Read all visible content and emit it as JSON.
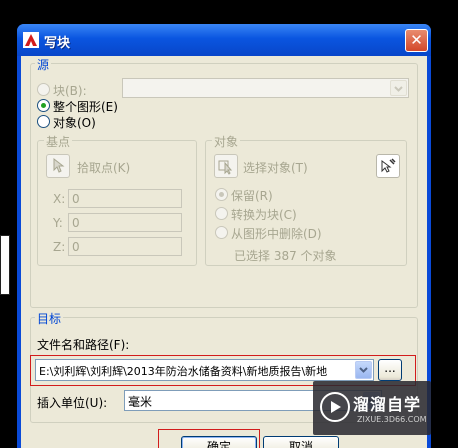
{
  "dialog": {
    "title": "写块",
    "close_label": "✕",
    "source": {
      "legend": "源",
      "block_label": "块(B):",
      "block_value": "",
      "whole_drawing_label": "整个图形(E)",
      "objects_label": "对象(O)",
      "selected": "whole_drawing"
    },
    "base_point": {
      "legend": "基点",
      "pick_point_label": "拾取点(K)",
      "x_label": "X:",
      "y_label": "Y:",
      "z_label": "Z:",
      "x_value": "0",
      "y_value": "0",
      "z_value": "0"
    },
    "objects": {
      "legend": "对象",
      "select_objects_label": "选择对象(T)",
      "retain_label": "保留(R)",
      "convert_label": "转换为块(C)",
      "delete_label": "从图形中删除(D)",
      "selected_count_text": "已选择 387 个对象"
    },
    "destination": {
      "legend": "目标",
      "file_path_label": "文件名和路径(F):",
      "file_path_value": "E:\\刘利辉\\刘利辉\\2013年防治水储备资料\\新地质报告\\新地",
      "browse_label": "...",
      "insert_units_label": "插入单位(U):",
      "insert_units_value": "毫米"
    },
    "buttons": {
      "ok_label": "确定",
      "cancel_label": "取消"
    }
  },
  "watermark": {
    "brand": "溜溜自学",
    "url": "ZIXUE.3D66.COM"
  },
  "colors": {
    "title_bar": "#0a55e0",
    "dialog_bg": "#ece9d8",
    "group_legend": "#0046d5",
    "highlight_box": "#d21c1c"
  }
}
